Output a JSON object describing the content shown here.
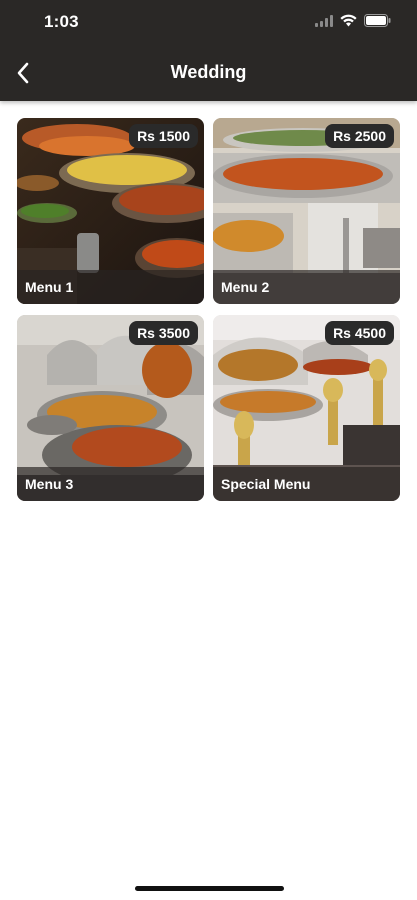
{
  "status_bar": {
    "time": "1:03"
  },
  "header": {
    "title": "Wedding",
    "back_icon": "chevron-left-icon"
  },
  "colors": {
    "header_bg": "#2a2826",
    "badge_bg": "#2a2a2a",
    "text": "#ffffff"
  },
  "menus": [
    {
      "name": "Menu 1",
      "price": "Rs 1500"
    },
    {
      "name": "Menu 2",
      "price": "Rs 2500"
    },
    {
      "name": "Menu 3",
      "price": "Rs 3500"
    },
    {
      "name": "Special Menu",
      "price": "Rs 4500"
    }
  ]
}
